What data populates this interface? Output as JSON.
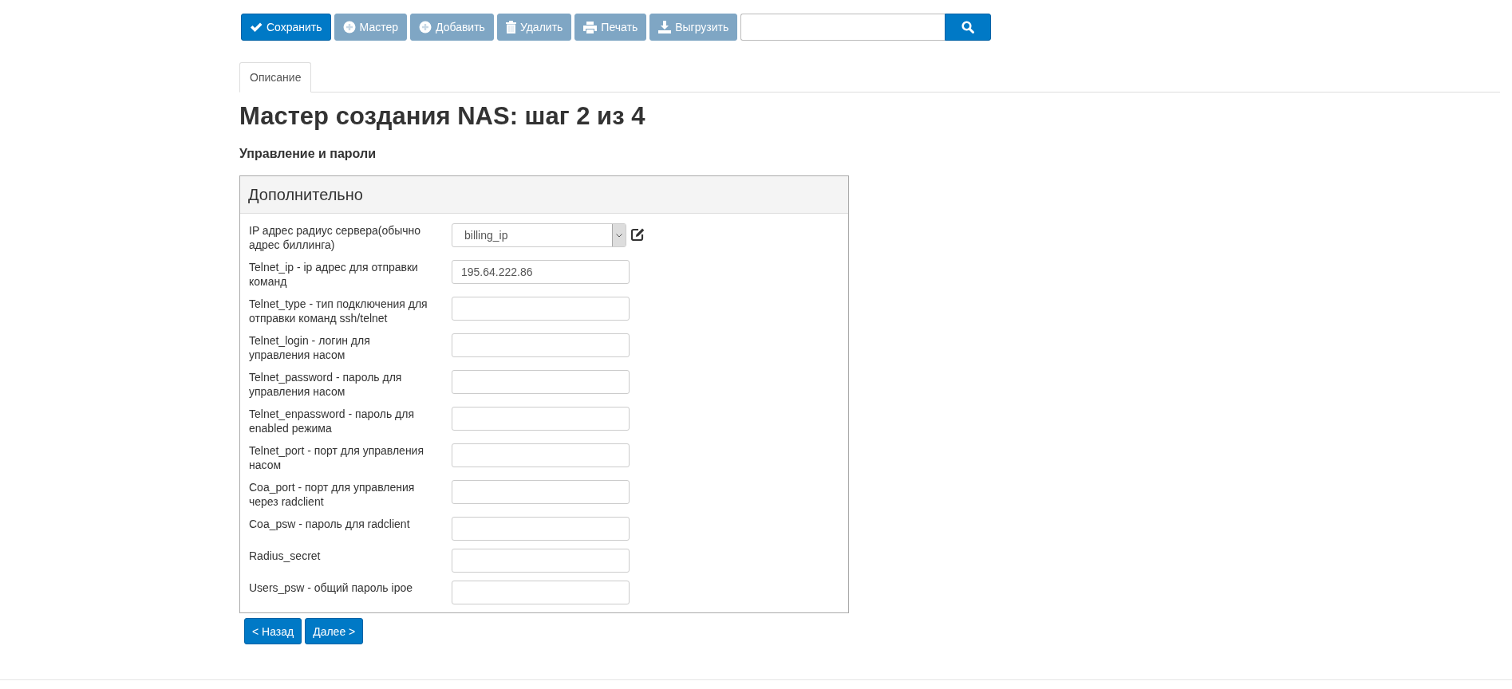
{
  "toolbar": {
    "buttons": [
      {
        "label": "Сохранить",
        "kind": "check",
        "disabled": false
      },
      {
        "label": "Мастер",
        "kind": "plus",
        "disabled": true
      },
      {
        "label": "Добавить",
        "kind": "plus",
        "disabled": true
      },
      {
        "label": "Удалить",
        "kind": "trash",
        "disabled": true
      },
      {
        "label": "Печать",
        "kind": "print",
        "disabled": true
      },
      {
        "label": "Выгрузить",
        "kind": "download",
        "disabled": true
      }
    ]
  },
  "tabs": [
    {
      "label": "Описание",
      "selected": true
    }
  ],
  "title": "Мастер создания NAS: шаг 2 из 4",
  "subtitle": "Управление и пароли",
  "panel": {
    "title": "Дополнительно",
    "fields": [
      {
        "label": "IP адрес радиус сервера(обычно адрес биллинга)",
        "kind": "select",
        "value": "billing_ip"
      },
      {
        "label": "Telnet_ip - ip адрес для отправки команд",
        "kind": "text",
        "value": "195.64.222.86"
      },
      {
        "label": "Telnet_type - тип подключения для отправки команд ssh/telnet",
        "kind": "text"
      },
      {
        "label": "Telnet_login - логин для управления насом",
        "kind": "text"
      },
      {
        "label": "Telnet_password - пароль для управления насом",
        "kind": "text"
      },
      {
        "label": "Telnet_enpassword - пароль для enabled режима",
        "kind": "text"
      },
      {
        "label": "Telnet_port - порт для управления насом",
        "kind": "text"
      },
      {
        "label": "Coa_port - порт для управления через radclient",
        "kind": "text"
      },
      {
        "label": "Coa_psw - пароль для radclient",
        "kind": "text"
      },
      {
        "label": "Radius_secret",
        "kind": "text"
      },
      {
        "label": "Users_psw - общий пароль ipoe",
        "kind": "text"
      }
    ]
  },
  "nav_buttons": [
    "< Назад",
    "Далее >"
  ]
}
